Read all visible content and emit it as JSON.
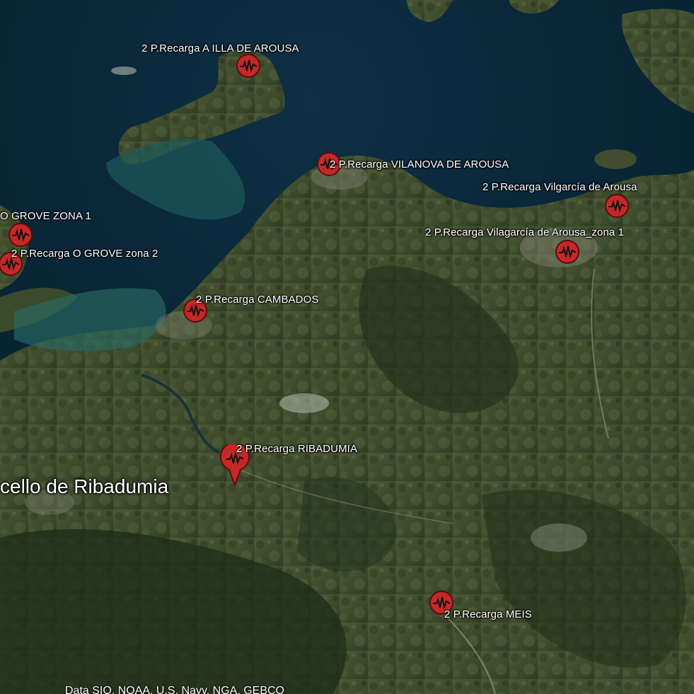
{
  "map": {
    "place_name": "cello de Ribadumia",
    "attribution": "Data SIO, NOAA, U.S. Navy, NGA, GEBCO",
    "marker_icon": "charging-station-icon",
    "pin_icon": "map-pin-icon",
    "marker_color": "#c62828",
    "water_color": "#0d2a3a"
  },
  "markers": [
    {
      "label": "2 P.Recarga A ILLA DE AROUSA"
    },
    {
      "label": "2 P.Recarga VILANOVA DE AROUSA"
    },
    {
      "label": "2 P.Recarga Vilgarcía de Arousa"
    },
    {
      "label": "2 P.Recarga Vilagarcía de Arousa_zona 1"
    },
    {
      "label": "O GROVE ZONA 1"
    },
    {
      "label": "2 P.Recarga  O GROVE zona 2"
    },
    {
      "label": "2 P.Recarga CAMBADOS"
    },
    {
      "label": "2 P.Recarga RIBADUMIA"
    },
    {
      "label": "2 P.Recarga MEIS"
    }
  ]
}
